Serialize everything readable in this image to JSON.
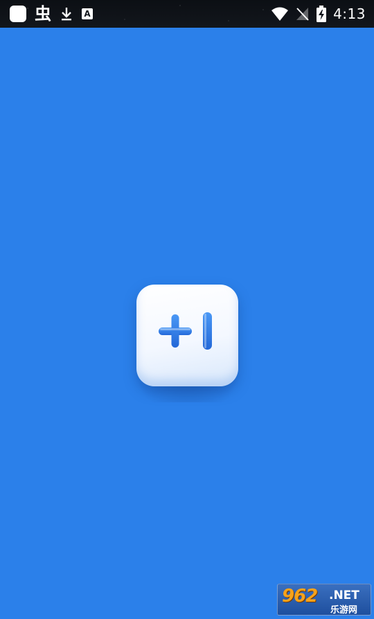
{
  "status_bar": {
    "time": "4:13",
    "bug_glyph": "虫",
    "a_badge": "A",
    "icons": [
      "app-square-icon",
      "bug-icon",
      "download-icon",
      "text-a-icon",
      "wifi-icon",
      "no-signal-icon",
      "battery-charging-icon"
    ]
  },
  "splash": {
    "logo_icon": "plus-one-icon",
    "background_color": "#2b80ea",
    "logo_color": "#2f7ee6"
  },
  "watermark": {
    "main": "962",
    "net": ".NET",
    "sub": "乐游网"
  }
}
